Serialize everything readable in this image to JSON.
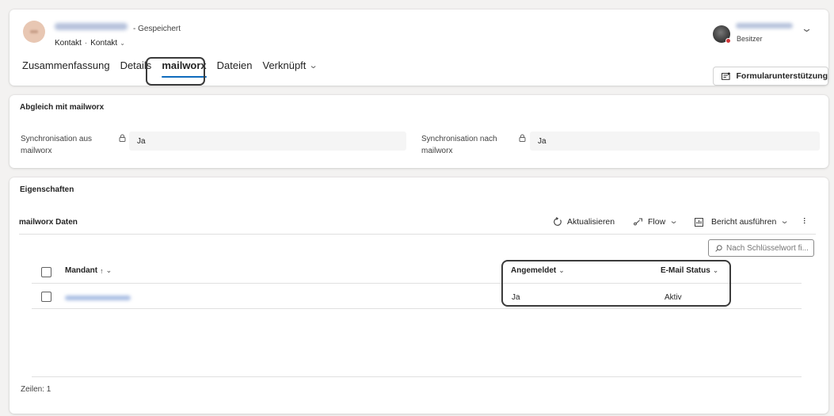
{
  "header": {
    "saved_status": "- Gespeichert",
    "entity_type": "Kontakt",
    "separator": "·",
    "form_name": "Kontakt",
    "owner_role": "Besitzer",
    "form_assist_label": "Formularunterstützung"
  },
  "tabs": [
    {
      "label": "Zusammenfassung",
      "active": false
    },
    {
      "label": "Details",
      "active": false
    },
    {
      "label": "mailworx",
      "active": true
    },
    {
      "label": "Dateien",
      "active": false
    },
    {
      "label": "Verknüpft",
      "active": false
    }
  ],
  "sync_section": {
    "title": "Abgleich mit mailworx",
    "from_label_line1": "Synchronisation aus",
    "from_label_line2": "mailworx",
    "from_value": "Ja",
    "to_label_line1": "Synchronisation nach",
    "to_label_line2": "mailworx",
    "to_value": "Ja"
  },
  "properties_section": {
    "title": "Eigenschaften",
    "subgrid_title": "mailworx Daten",
    "commands": {
      "refresh": "Aktualisieren",
      "flow": "Flow",
      "report": "Bericht ausführen"
    },
    "search_placeholder": "Nach Schlüsselwort fi...",
    "columns": {
      "mandant": "Mandant",
      "angemeldet": "Angemeldet",
      "email_status": "E-Mail Status"
    },
    "rows": [
      {
        "angemeldet": "Ja",
        "email_status": "Aktiv"
      }
    ],
    "rows_count": "Zeilen: 1"
  },
  "colors": {
    "accent": "#0f6cbd",
    "presence_busy": "#d13438",
    "highlight_border": "#3b3b3b"
  },
  "icons": [
    "lock-icon",
    "refresh-icon",
    "flow-icon",
    "report-icon",
    "search-icon",
    "form-assist-icon",
    "chevron-down-icon",
    "more-icon"
  ]
}
